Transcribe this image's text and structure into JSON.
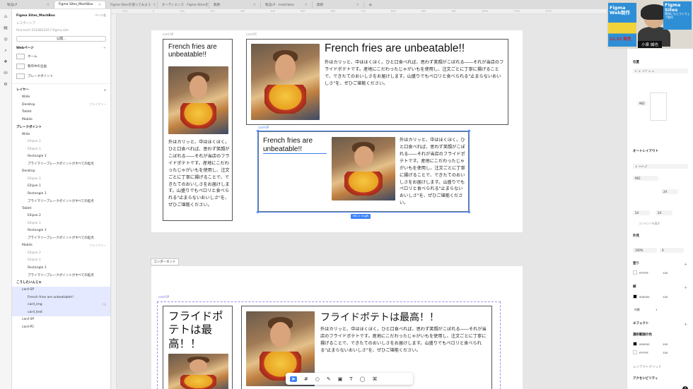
{
  "tabs": [
    "製品LP",
    "Figma Sites_MachBox",
    "Figma Sitesを使ってみよう",
    "オーディエンス · Figma Sitesを使って",
    "無題",
    "製品LP - matchbox",
    "無題"
  ],
  "left": {
    "file_name": "Figma Sites_MachBox",
    "page_label": "ページ名",
    "team": "レスポンシブ",
    "url": "fine-tech-5218822917.figma.site",
    "publish": "公開...",
    "webpages_title": "Webページ",
    "pages": [
      "ホーム",
      "製作中の企画",
      "ブレークポイント"
    ],
    "layers_title": "レイヤー",
    "layers": [
      {
        "t": "Wide",
        "c": "ind1"
      },
      {
        "t": "Desktop",
        "c": "ind1",
        "r": "プライマリー"
      },
      {
        "t": "Tablet",
        "c": "ind1"
      },
      {
        "t": "Mobile",
        "c": "ind1"
      },
      {
        "t": "ブレークポイント",
        "c": "hd"
      },
      {
        "t": "Wide",
        "c": "ind1"
      },
      {
        "t": "Ellipse 2",
        "c": "ind2 dim"
      },
      {
        "t": "Ellipse 1",
        "c": "ind2 dim"
      },
      {
        "t": "Rectangle 1",
        "c": "ind2"
      },
      {
        "t": "プライマリーブレークポイントがすべての起点",
        "c": "ind2"
      },
      {
        "t": "Desktop",
        "c": "ind1"
      },
      {
        "t": "Ellipse 2",
        "c": "ind2 dim"
      },
      {
        "t": "Ellipse 1",
        "c": "ind2"
      },
      {
        "t": "Rectangle 1",
        "c": "ind2"
      },
      {
        "t": "プライマリーブレークポイントがすべての起点",
        "c": "ind2"
      },
      {
        "t": "Tablet",
        "c": "ind1"
      },
      {
        "t": "Ellipse 2",
        "c": "ind2"
      },
      {
        "t": "Ellipse 1",
        "c": "ind2 dim"
      },
      {
        "t": "Rectangle 1",
        "c": "ind2"
      },
      {
        "t": "プライマリーブレークポイントがすべての起点",
        "c": "ind2"
      },
      {
        "t": "Mobile",
        "c": "ind1",
        "r": "プライマリー"
      },
      {
        "t": "Ellipse 2",
        "c": "ind2 dim"
      },
      {
        "t": "Ellipse 1",
        "c": "ind2 dim"
      },
      {
        "t": "Rectangle 1",
        "c": "ind2"
      },
      {
        "t": "プライマリーブレークポイントがすべての起点",
        "c": "ind2"
      },
      {
        "t": "こうしたいんじゃ",
        "c": "hd"
      },
      {
        "t": "card-SP",
        "c": "ind1 sel"
      },
      {
        "t": "French fries are unbeatable!!",
        "c": "ind2 sel"
      },
      {
        "t": "card_img",
        "c": "ind2 sel",
        "r": "Fill"
      },
      {
        "t": "card_text",
        "c": "ind2 sel"
      },
      {
        "t": "card-SP",
        "c": "ind1"
      },
      {
        "t": "card-PC",
        "c": "ind1"
      }
    ]
  },
  "canvas": {
    "ruler": [
      "-100",
      "0",
      "100",
      "200",
      "300",
      "400",
      "500",
      "600",
      "700",
      "800",
      "900",
      "962",
      "1000",
      "1100",
      "1200"
    ],
    "card_sp_label": "card-SP",
    "card_pc_label": "card-PC",
    "size_badge": "962 × Hug内",
    "component_label": "コンポーネント",
    "title_en": "French fries are unbeatable!!",
    "title_ja": "フライドポテトは最高！！",
    "body": "外はカリッと、中はほくほく。ひと口食べれば、思わず笑顔がこぼれる――それが当店のフライドポテトです。産地にこだわったじゃがいもを使用し、注文ごとに丁寧に揚げることで、できたてのおいしさをお届けします。山盛りでもペロリと食べられる\"止まらないおいしさ\"を、ぜひご堪能ください。"
  },
  "right": {
    "pos": "位置",
    "auto": "オートレイアウト",
    "w": "962",
    "gap": "24",
    "pad": "24",
    "clip": "コンテンツを隠す",
    "appearance": "外見",
    "opacity": "100%",
    "radius": "4",
    "fill": "塗り",
    "fill_hex": "FFFFFF",
    "pct": "100",
    "stroke": "線",
    "stroke_hex": "000000",
    "inner": "内側",
    "one": "1",
    "effects": "エフェクト",
    "sel_colors": "選択範囲の色",
    "c1": "000000",
    "c2": "FFFFFF",
    "guides": "レイアウトグリッド",
    "a11y": "アクセシビリティ"
  },
  "video": {
    "book_title": "Figma Web制作",
    "date": "11.21 発売",
    "name": "小泉 誠也",
    "fs_title": "Figma Sites",
    "fs_sub": "実例にもとづくウェブ制作"
  },
  "colors": {
    "accent": "#3b82f6",
    "component": "#9b8cf0"
  }
}
